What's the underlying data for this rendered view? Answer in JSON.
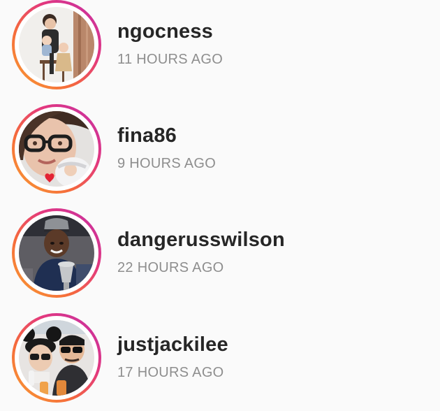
{
  "stories": [
    {
      "username": "ngocness",
      "time": "11 HOURS AGO"
    },
    {
      "username": "fina86",
      "time": "9 HOURS AGO"
    },
    {
      "username": "dangerusswilson",
      "time": "22 HOURS AGO"
    },
    {
      "username": "justjackilee",
      "time": "17 HOURS AGO"
    }
  ],
  "colors": {
    "ring_gradient": [
      "#f9a031",
      "#f56a3c",
      "#e3387e",
      "#c22fa8"
    ],
    "username": "#262626",
    "time": "#8e8e8e",
    "background": "#fafafa"
  }
}
